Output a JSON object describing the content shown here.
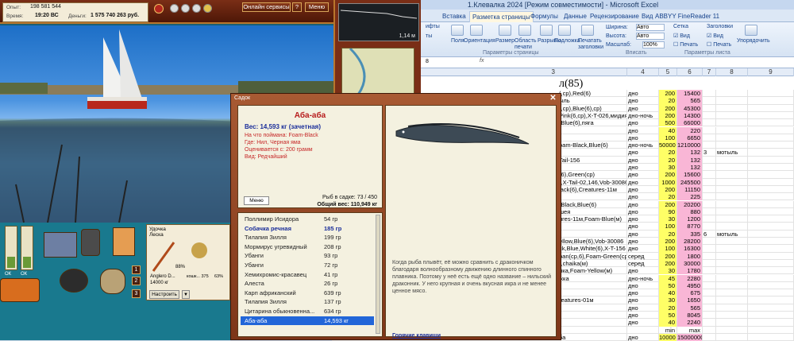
{
  "excel": {
    "title": "1.Клевалка 2024  [Режим совместимости] - Microsoft Excel",
    "tabs": [
      "Вставка",
      "Разметка страницы",
      "Формулы",
      "Данные",
      "Рецензирование",
      "Вид",
      "ABBYY FineReader 11"
    ],
    "ribbon": {
      "fields": "Поля",
      "orientation": "Ориентация",
      "size": "Размер",
      "print_area": "Область печати",
      "breaks": "Разрывы",
      "background": "Подложка",
      "print_titles": "Печатать заголовки",
      "width_label": "Ширина:",
      "width_value": "Авто",
      "height_label": "Высота:",
      "height_value": "Авто",
      "scale_label": "Масштаб:",
      "scale_value": "100%",
      "grid_label": "Сетка",
      "headers_label": "Заголовки",
      "view_label": "Вид",
      "print_label": "Печать",
      "arrange_label": "Упорядочить",
      "group_page_setup": "Параметры страницы",
      "group_fit": "Вписать",
      "group_sheet": "Параметры листа",
      "left_frag1": "ифты",
      "left_frag2": "ты"
    },
    "cell_ref": "8",
    "fx": "fx",
    "columns": [
      "3",
      "4",
      "5",
      "6",
      "7",
      "8",
      "9"
    ],
    "big_title": "л(85)",
    "rows": [
      [
        "(,cp),Red(6)",
        "дно",
        "200",
        "15400",
        "",
        "",
        ""
      ],
      [
        "ыль",
        "дно",
        "20",
        "565",
        "",
        "",
        ""
      ],
      [
        "(,cp),Blue(6),cp)",
        "дно",
        "200",
        "45300",
        "",
        "",
        ""
      ],
      [
        "Pink(6,cp),X-T-026,мидия",
        "дно-ночь",
        "200",
        "14300",
        "",
        "",
        ""
      ],
      [
        "-Blue(6),пяга",
        "дно",
        "500",
        "66000",
        "",
        "",
        ""
      ],
      [
        "",
        "дно",
        "40",
        "220",
        "",
        "",
        ""
      ],
      [
        "",
        "дно",
        "100",
        "6650",
        "",
        "",
        ""
      ],
      [
        "oam-Black,Blue(6)",
        "дно-ночь",
        "50000",
        "1210000",
        "",
        "",
        ""
      ],
      [
        "",
        "дно",
        "20",
        "132",
        "3",
        "мотыль",
        ""
      ],
      [
        "Tail-156",
        "дно",
        "20",
        "132",
        "",
        "",
        ""
      ],
      [
        "",
        "дно",
        "30",
        "132",
        "",
        "",
        ""
      ],
      [
        "(6),Green(cp)",
        "дно",
        "200",
        "15600",
        "",
        "",
        ""
      ],
      [
        "),X-Tail-02,146,Vob-30086",
        "дно",
        "1000",
        "245500",
        "",
        "",
        ""
      ],
      [
        "lack(6),Creatures-11м",
        "дно",
        "200",
        "11150",
        "",
        "",
        ""
      ],
      [
        "",
        "дно",
        "20",
        "225",
        "",
        "",
        ""
      ],
      [
        "-Black,Blue(6)",
        "дно",
        "200",
        "20200",
        "",
        "",
        ""
      ],
      [
        "шея",
        "дно",
        "90",
        "880",
        "",
        "",
        ""
      ],
      [
        "ures-11м,Foam-Blue(м)",
        "дно",
        "30",
        "1200",
        "",
        "",
        ""
      ],
      [
        "",
        "дно",
        "100",
        "8770",
        "",
        "",
        ""
      ],
      [
        "",
        "дно",
        "20",
        "335",
        "6",
        "мотыль",
        ""
      ],
      [
        "ellow,Blue(6),Vob-30086",
        "дно",
        "200",
        "28200",
        "",
        "",
        ""
      ],
      [
        "ck,Blue,White(6),X-T-156",
        "дно",
        "100",
        "16300",
        "",
        "",
        ""
      ],
      [
        "pan(cp,6),Foam-Green(cp)",
        "серед",
        "200",
        "1800",
        "",
        "",
        ""
      ],
      [
        "),chaika(м)",
        "серед",
        "200",
        "30000",
        "",
        "",
        ""
      ],
      [
        "йка,Foam-Yellow(м)",
        "дно",
        "30",
        "1780",
        "",
        "",
        ""
      ],
      [
        "жка",
        "дно-ночь",
        "45",
        "2280",
        "",
        "",
        ""
      ],
      [
        "",
        "дно",
        "50",
        "4950",
        "",
        "",
        ""
      ],
      [
        "",
        "дно",
        "40",
        "675",
        "",
        "",
        ""
      ],
      [
        "reatures-01м",
        "дно",
        "30",
        "1650",
        "",
        "",
        ""
      ],
      [
        "",
        "дно",
        "20",
        "565",
        "",
        "",
        ""
      ],
      [
        "",
        "дно",
        "50",
        "8045",
        "",
        "",
        ""
      ],
      [
        "",
        "дно",
        "40",
        "2240",
        "",
        "",
        ""
      ],
      [
        "",
        "",
        "min",
        "max",
        "",
        "",
        ""
      ],
      [
        "ба",
        "дно",
        "10000",
        "15000000",
        "",
        "",
        ""
      ]
    ]
  },
  "game": {
    "exp_label": "Опыт:",
    "exp_value": "198 581 544",
    "time_label": "Время:",
    "time_value": "19:20 ВС",
    "money_label": "Деньги:",
    "money_value": "1 575 740 263 руб.",
    "online_btn": "Онлайн сервисы",
    "help_btn": "?",
    "menu_btn": "Меню",
    "depth": "1,14 м",
    "rod_tab1": "Удочка",
    "rod_tab2": "Леска",
    "rod_name": "Anglero D...",
    "rod_weight": "14000 кг",
    "rod_pct": "88%",
    "reel_label": "кошк... 375",
    "reel_pct": "63%",
    "slots": [
      "1",
      "2",
      "3"
    ],
    "setup_btn": "Настроить",
    "gauge_left": "ОК",
    "gauge_right": "ОК"
  },
  "dialog": {
    "title": "Садок",
    "fish_name": "Аба-аба",
    "weight": "Вес: 14,593 кг (зачетная)",
    "caught_on": "На что поймана: Foam-Black",
    "place": "Где: Нил, Черная яма",
    "value": "Оценивается с: 200 грамм",
    "kind": "Вид: Редчайший",
    "menu_btn": "Меню",
    "count": "Рыб в садке: 73 / 450",
    "total": "Общий вес: 110,949 кг",
    "list": [
      {
        "name": "Поллимир Исидора",
        "weight": "54 гр"
      },
      {
        "name": "Собачка речная",
        "weight": "185 гр"
      },
      {
        "name": "Тилапия Зилля",
        "weight": "199 гр"
      },
      {
        "name": "Мормирус угревидный",
        "weight": "208 гр"
      },
      {
        "name": "Убанги",
        "weight": "93 гр"
      },
      {
        "name": "Убанги",
        "weight": "72 гр"
      },
      {
        "name": "Хемихромис-красавец",
        "weight": "41 гр"
      },
      {
        "name": "Алеста",
        "weight": "26 гр"
      },
      {
        "name": "Карп африканский",
        "weight": "639 гр"
      },
      {
        "name": "Тилапия Зилля",
        "weight": "137 гр"
      },
      {
        "name": "Цитарина обыкновенна...",
        "weight": "634 гр"
      },
      {
        "name": "Аба-аба",
        "weight": "14,593 кг"
      }
    ],
    "description": "Когда рыба плывёт, её можно сравнить с драконичком благодаря волнообразному движению длинного спинного плавника. Поэтому у неё есть ещё одно название – нильский драконник. У него крупная и очень вкусная икра и не менее ценное мясо.",
    "hotkeys": "Горячие клавиши"
  }
}
